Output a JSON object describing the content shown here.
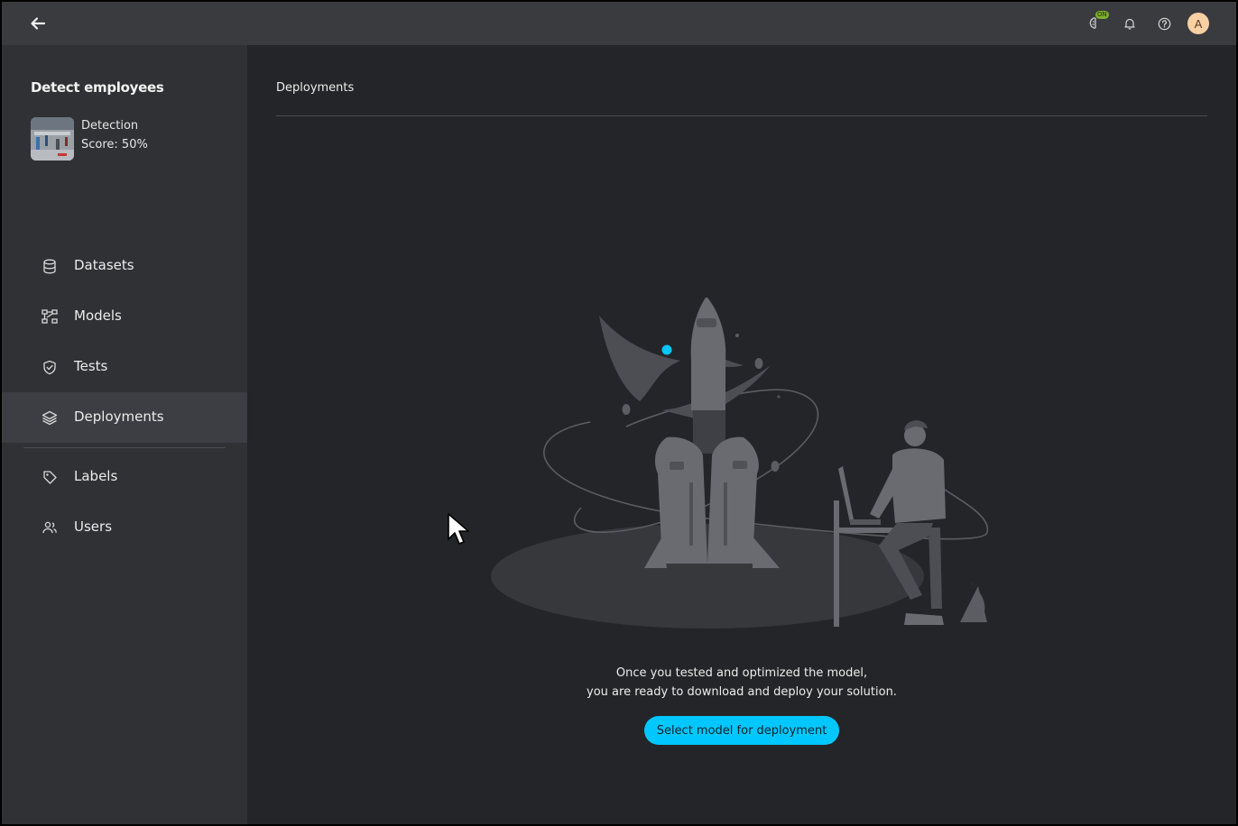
{
  "topbar": {
    "back_icon": "arrow-left-icon",
    "status_badge": "ON",
    "icons": [
      "brain-icon",
      "bell-icon",
      "help-icon"
    ],
    "avatar_initial": "A"
  },
  "project": {
    "title": "Detect employees",
    "task_type": "Detection",
    "score": "Score: 50%"
  },
  "sidebar": {
    "items": [
      {
        "label": "Datasets",
        "icon": "database-icon"
      },
      {
        "label": "Models",
        "icon": "models-icon"
      },
      {
        "label": "Tests",
        "icon": "shield-check-icon"
      },
      {
        "label": "Deployments",
        "icon": "layers-icon",
        "active": true
      },
      {
        "label": "Labels",
        "icon": "tag-icon"
      },
      {
        "label": "Users",
        "icon": "users-icon"
      }
    ]
  },
  "main": {
    "title": "Deployments",
    "empty_line1": "Once you tested and optimized the model,",
    "empty_line2": "you are ready to download and deploy your solution.",
    "cta_label": "Select model for deployment"
  },
  "colors": {
    "accent": "#00c7fd",
    "badge": "#7fae2d",
    "avatar_bg": "#f9cfa4",
    "sidebar_bg": "#303135",
    "main_bg": "#242528"
  }
}
